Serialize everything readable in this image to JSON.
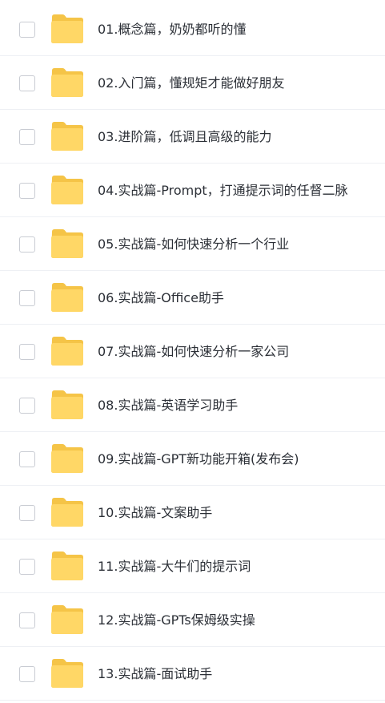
{
  "icon": "folder-icon",
  "colors": {
    "folder_back": "#F5C447",
    "folder_front": "#FFD766",
    "text": "#2B2F36",
    "divider": "#EEF0F4"
  },
  "files": [
    {
      "name": "01.概念篇，奶奶都听的懂"
    },
    {
      "name": "02.入门篇，懂规矩才能做好朋友"
    },
    {
      "name": "03.进阶篇，低调且高级的能力"
    },
    {
      "name": "04.实战篇-Prompt，打通提示词的任督二脉"
    },
    {
      "name": "05.实战篇-如何快速分析一个行业"
    },
    {
      "name": "06.实战篇-Office助手"
    },
    {
      "name": "07.实战篇-如何快速分析一家公司"
    },
    {
      "name": "08.实战篇-英语学习助手"
    },
    {
      "name": "09.实战篇-GPT新功能开箱(发布会)"
    },
    {
      "name": "10.实战篇-文案助手"
    },
    {
      "name": "11.实战篇-大牛们的提示词"
    },
    {
      "name": "12.实战篇-GPTs保姆级实操"
    },
    {
      "name": "13.实战篇-面试助手"
    }
  ]
}
